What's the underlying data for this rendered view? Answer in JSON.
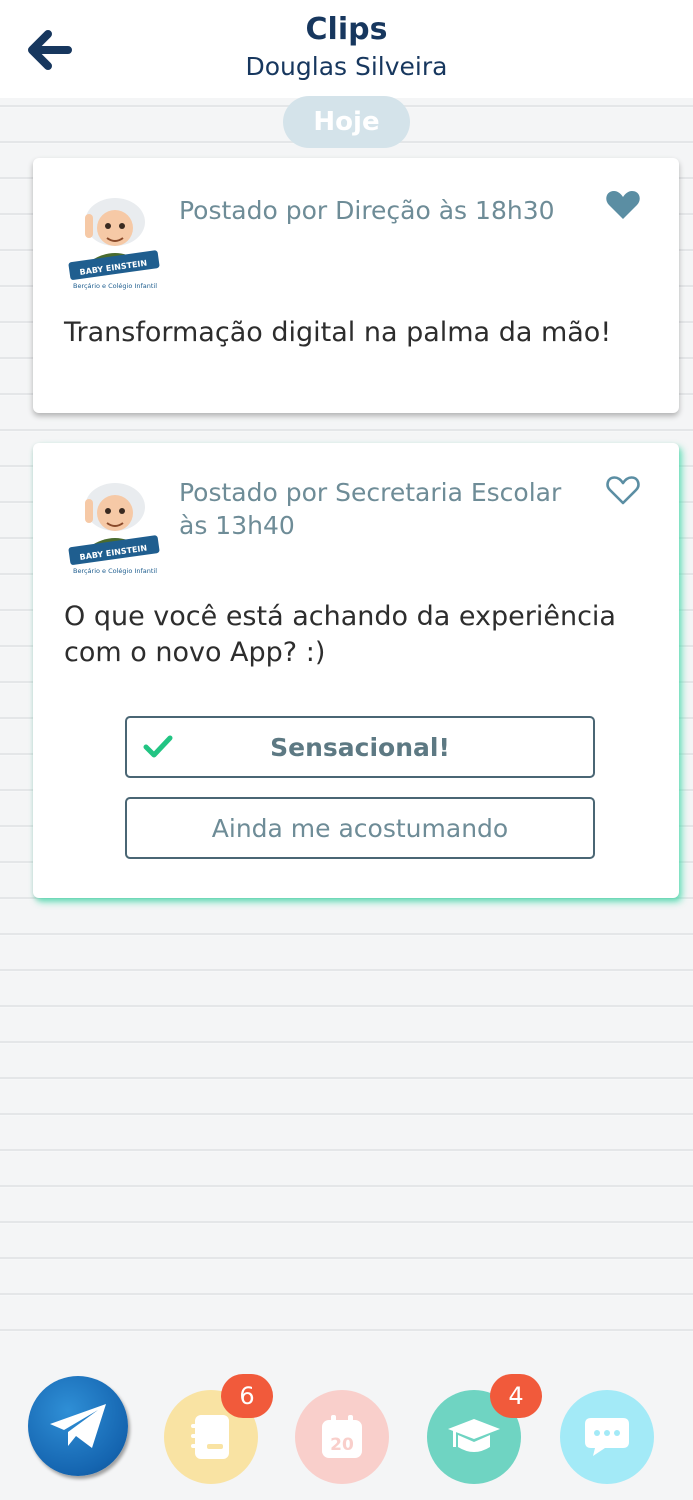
{
  "header": {
    "title": "Clips",
    "subtitle": "Douglas Silveira"
  },
  "date_label": "Hoje",
  "posts": [
    {
      "meta": "Postado por Direção às 18h30",
      "message": "Transformação digital na palma da mão!",
      "liked": true,
      "logo_text": [
        "BABY EINSTEIN",
        "Berçário e Colégio Infantil"
      ]
    },
    {
      "meta": "Postado por Secretaria Escolar às 13h40",
      "message": "O que você está achando da experiência com o novo App? :)",
      "liked": false,
      "logo_text": [
        "BABY EINSTEIN",
        "Berçário e Colégio Infantil"
      ],
      "options": [
        {
          "label": "Sensacional!",
          "selected": true
        },
        {
          "label": "Ainda me acostumando",
          "selected": false
        }
      ]
    }
  ],
  "nav": {
    "notebook_badge": "6",
    "calendar_day": "20",
    "school_badge": "4"
  },
  "colors": {
    "header_text": "#17375e",
    "meta_text": "#6e8c97",
    "heart": "#5b8ea3",
    "check": "#22c483",
    "card_highlight": "#3cdca9",
    "badge": "#f15a3b"
  }
}
